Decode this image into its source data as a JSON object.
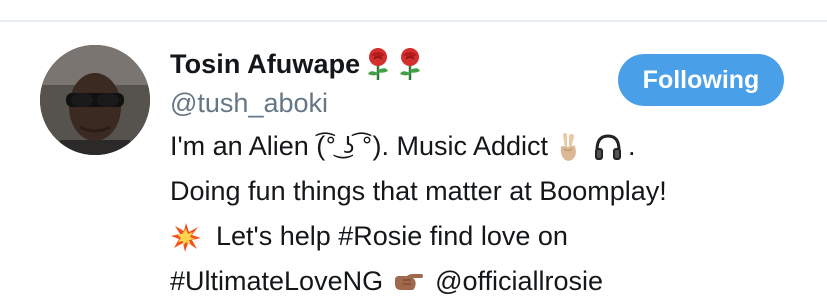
{
  "profile": {
    "display_name": "Tosin Afuwape",
    "name_emojis": [
      "rose-emoji",
      "rose-emoji"
    ],
    "handle": "@tush_aboki",
    "follow_button_label": "Following"
  },
  "bio": {
    "line1_before": "I'm an Alien (",
    "line1_face": "͡° ͜ʖ ͡°",
    "line1_after": "). Music Addict",
    "line1_emojis": [
      "victory-hand-emoji",
      "headphones-emoji"
    ],
    "line1_end": ".",
    "line2": "Doing fun things that matter at Boomplay!",
    "line3_emoji": "collision-emoji",
    "line3_text": "Let's help #Rosie find love on",
    "line4_hashtag": "#UltimateLoveNG",
    "line4_emoji": "pointing-right-emoji",
    "line4_mention": "@officiallrosie"
  },
  "colors": {
    "follow_button_bg": "#4a9fe9",
    "handle": "#657786",
    "text": "#14171a",
    "divider": "#e6ecf0"
  }
}
